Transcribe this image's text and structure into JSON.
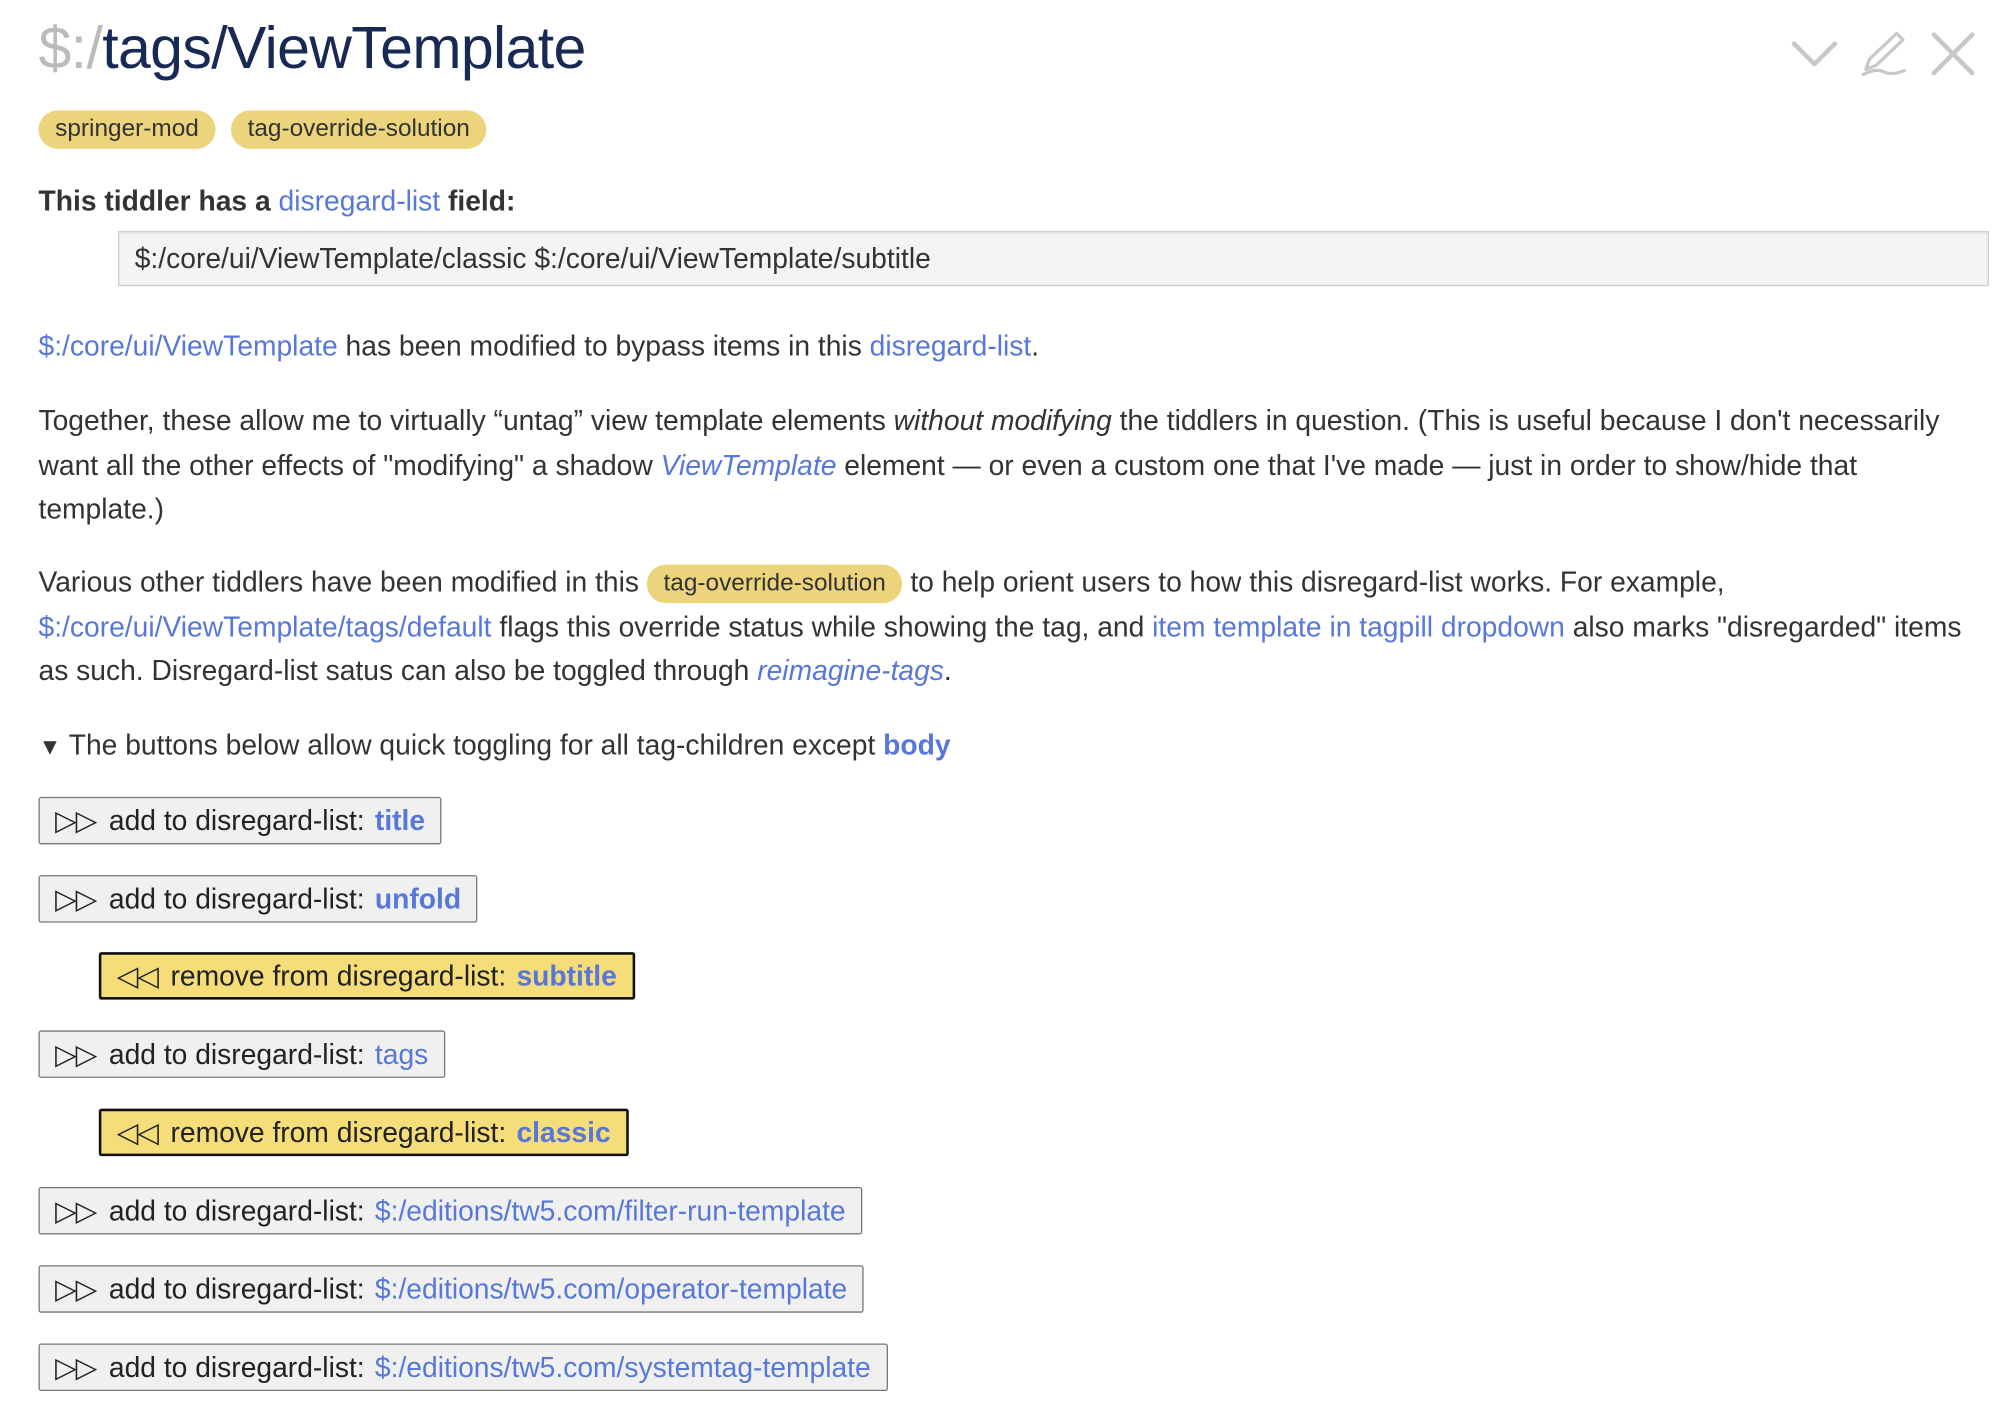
{
  "title": {
    "prefix": "$:/",
    "main": "tags/ViewTemplate"
  },
  "tags": [
    "springer-mod",
    "tag-override-solution"
  ],
  "field_label": {
    "pre": "This tiddler has a ",
    "link": "disregard-list",
    "post": " field:"
  },
  "field_value": "$:/core/ui/ViewTemplate/classic $:/core/ui/ViewTemplate/subtitle",
  "para1": {
    "link1": "$:/core/ui/ViewTemplate",
    "text": " has been modified to bypass items in this ",
    "link2": "disregard-list",
    "end": "."
  },
  "para2": {
    "t1": "Together, these allow me to virtually “untag” view template elements ",
    "em": "without modifying",
    "t2": " the tiddlers in question. (This is useful because I don't necessarily want all the other effects of \"modifying\" a shadow ",
    "link": "ViewTemplate",
    "t3": " element — or even a custom one that I've made — just in order to show/hide that template.)"
  },
  "para3": {
    "t1": "Various other tiddlers have been modified in this ",
    "tag": "tag-override-solution",
    "t2": " to help orient users to how this disregard-list works. For example, ",
    "link1": "$:/core/ui/ViewTemplate/tags/default",
    "t3": " flags this override status while showing the tag, and ",
    "link2": "item template in tagpill dropdown",
    "t4": " also marks \"disregarded\" items as such. Disregard-list satus can also be toggled through ",
    "link3": "reimagine-tags",
    "end": "."
  },
  "details": {
    "arrow": "▼",
    "text": " The buttons below allow quick toggling for all tag-children except ",
    "link": "body"
  },
  "buttons": [
    {
      "arrow": "▷▷",
      "label": "add to disregard-list:",
      "target": "title"
    },
    {
      "arrow": "▷▷",
      "label": "add to disregard-list:",
      "target": "unfold"
    },
    {
      "arrow": "◁◁",
      "label": "remove from disregard-list:",
      "target": "subtitle"
    },
    {
      "arrow": "▷▷",
      "label": "add to disregard-list:",
      "target": "tags"
    },
    {
      "arrow": "◁◁",
      "label": "remove from disregard-list:",
      "target": "classic"
    },
    {
      "arrow": "▷▷",
      "label": "add to disregard-list:",
      "target": "$:/editions/tw5.com/filter-run-template"
    },
    {
      "arrow": "▷▷",
      "label": "add to disregard-list:",
      "target": "$:/editions/tw5.com/operator-template"
    },
    {
      "arrow": "▷▷",
      "label": "add to disregard-list:",
      "target": "$:/editions/tw5.com/systemtag-template"
    }
  ],
  "icons": [
    "chevron-down-icon",
    "edit-icon",
    "close-icon"
  ],
  "colors": {
    "link": "#5778d8",
    "tag": "#ecd47c",
    "title": "#182955",
    "active_button": "#f5dd7a"
  }
}
